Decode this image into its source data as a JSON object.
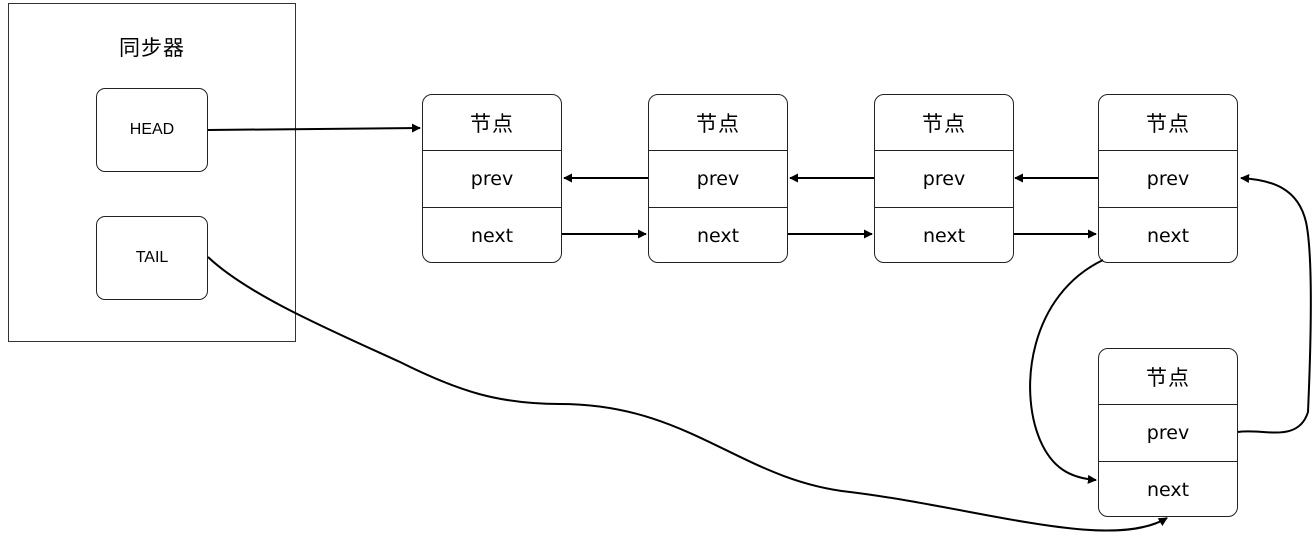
{
  "synchronizer": {
    "title": "同步器",
    "head_label": "HEAD",
    "tail_label": "TAIL"
  },
  "nodes": [
    {
      "title": "节点",
      "prev": "prev",
      "next": "next"
    },
    {
      "title": "节点",
      "prev": "prev",
      "next": "next"
    },
    {
      "title": "节点",
      "prev": "prev",
      "next": "next"
    },
    {
      "title": "节点",
      "prev": "prev",
      "next": "next"
    },
    {
      "title": "节点",
      "prev": "prev",
      "next": "next"
    }
  ]
}
